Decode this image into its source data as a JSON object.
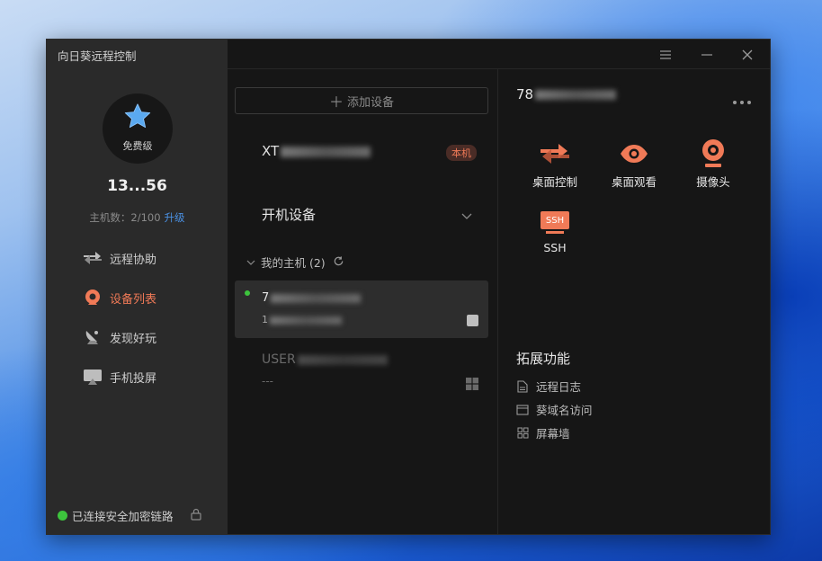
{
  "window": {
    "title": "向日葵远程控制"
  },
  "profile": {
    "tier": "免费级",
    "user_id": "13...56",
    "host_count_label": "主机数：2/100",
    "upgrade_label": "升级"
  },
  "nav": {
    "items": [
      {
        "label": "远程协助",
        "icon": "swap-arrows-icon"
      },
      {
        "label": "设备列表",
        "icon": "device-list-icon"
      },
      {
        "label": "发现好玩",
        "icon": "satellite-dish-icon"
      },
      {
        "label": "手机投屏",
        "icon": "screen-cast-icon"
      }
    ],
    "active": "设备列表"
  },
  "status": {
    "text": "已连接安全加密链路"
  },
  "device_panel": {
    "add_button": "添加设备",
    "local_device": {
      "name_prefix": "XT",
      "badge": "本机"
    },
    "section_title": "开机设备",
    "group": {
      "label": "我的主机 (2)"
    },
    "devices": [
      {
        "name_prefix": "7",
        "ip_prefix": "1",
        "online": true,
        "os": "app"
      },
      {
        "name_prefix": "USER",
        "ip": "---",
        "online": false,
        "os": "windows"
      }
    ]
  },
  "detail": {
    "device_id_prefix": "78",
    "actions": [
      {
        "label": "桌面控制",
        "icon": "desktop-control-icon"
      },
      {
        "label": "桌面观看",
        "icon": "eye-icon"
      },
      {
        "label": "摄像头",
        "icon": "camera-icon"
      },
      {
        "label": "SSH",
        "icon": "ssh-icon",
        "icon_text": "SSH"
      }
    ],
    "extensions_title": "拓展功能",
    "extensions": [
      {
        "label": "远程日志",
        "icon": "document-icon"
      },
      {
        "label": "葵域名访问",
        "icon": "browser-icon"
      },
      {
        "label": "屏幕墙",
        "icon": "grid-icon"
      }
    ]
  },
  "colors": {
    "accent": "#f07a57",
    "online": "#3dc43d",
    "link": "#4a90e2",
    "sidebar_bg": "#2a2a2a",
    "main_bg": "#161616"
  }
}
